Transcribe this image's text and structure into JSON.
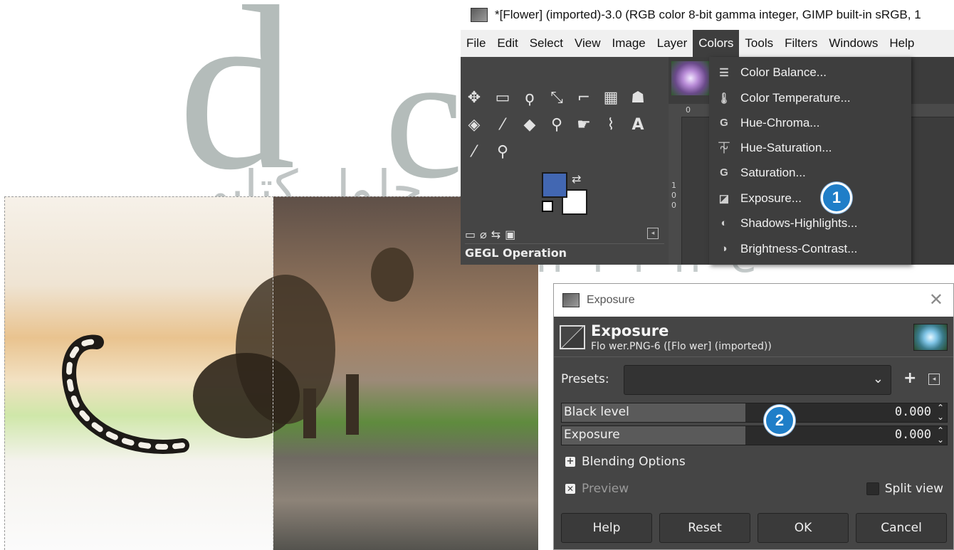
{
  "main_window": {
    "title": "*[Flower] (imported)-3.0 (RGB color 8-bit gamma integer, GIMP built-in sRGB, 1",
    "menu": [
      "File",
      "Edit",
      "Select",
      "View",
      "Image",
      "Layer",
      "Colors",
      "Tools",
      "Filters",
      "Windows",
      "Help"
    ],
    "active_menu": "Colors",
    "toolbox": {
      "fg_color": "#4267b2",
      "bg_color": "#ffffff",
      "tools": [
        "move-tool-icon",
        "rect-select-icon",
        "lasso-icon",
        "fuzzy-select-icon",
        "crop-icon",
        "unified-transform-icon",
        "warp-icon",
        "bucket-fill-icon",
        "paintbrush-icon",
        "eraser-icon",
        "clone-icon",
        "smudge-icon",
        "paths-icon",
        "text-icon",
        "color-picker-icon",
        "zoom-icon"
      ],
      "text_tool_glyph": "A",
      "panel_label": "GEGL Operation"
    },
    "ruler": {
      "h_mark": "0",
      "v_marks": [
        "1",
        "0",
        "0"
      ]
    }
  },
  "colors_menu": {
    "items": [
      {
        "label": "Color Balance...",
        "icon": "color-balance-icon"
      },
      {
        "label": "Color Temperature...",
        "icon": "thermometer-icon"
      },
      {
        "label": "Hue-Chroma...",
        "icon": "gegl-icon"
      },
      {
        "label": "Hue-Saturation...",
        "icon": "hue-saturation-icon"
      },
      {
        "label": "Saturation...",
        "icon": "gegl-icon"
      },
      {
        "label": "Exposure...",
        "icon": "exposure-icon"
      },
      {
        "label": "Shadows-Highlights...",
        "icon": "shadows-highlights-icon"
      },
      {
        "label": "Brightness-Contrast...",
        "icon": "brightness-contrast-icon"
      }
    ]
  },
  "callouts": {
    "one": "1",
    "two": "2"
  },
  "exposure_dialog": {
    "window_title": "Exposure",
    "header_title": "Exposure",
    "header_subtitle": "Flo wer.PNG-6 ([Flo wer] (imported))",
    "presets_label": "Presets:",
    "presets_value": "",
    "fields": [
      {
        "label": "Black level",
        "value": "0.000"
      },
      {
        "label": "Exposure",
        "value": "0.000"
      }
    ],
    "blending_label": "Blending Options",
    "preview_label": "Preview",
    "preview_checked": true,
    "split_view_label": "Split view",
    "split_view_checked": false,
    "buttons": {
      "help": "Help",
      "reset": "Reset",
      "ok": "OK",
      "cancel": "Cancel"
    }
  }
}
